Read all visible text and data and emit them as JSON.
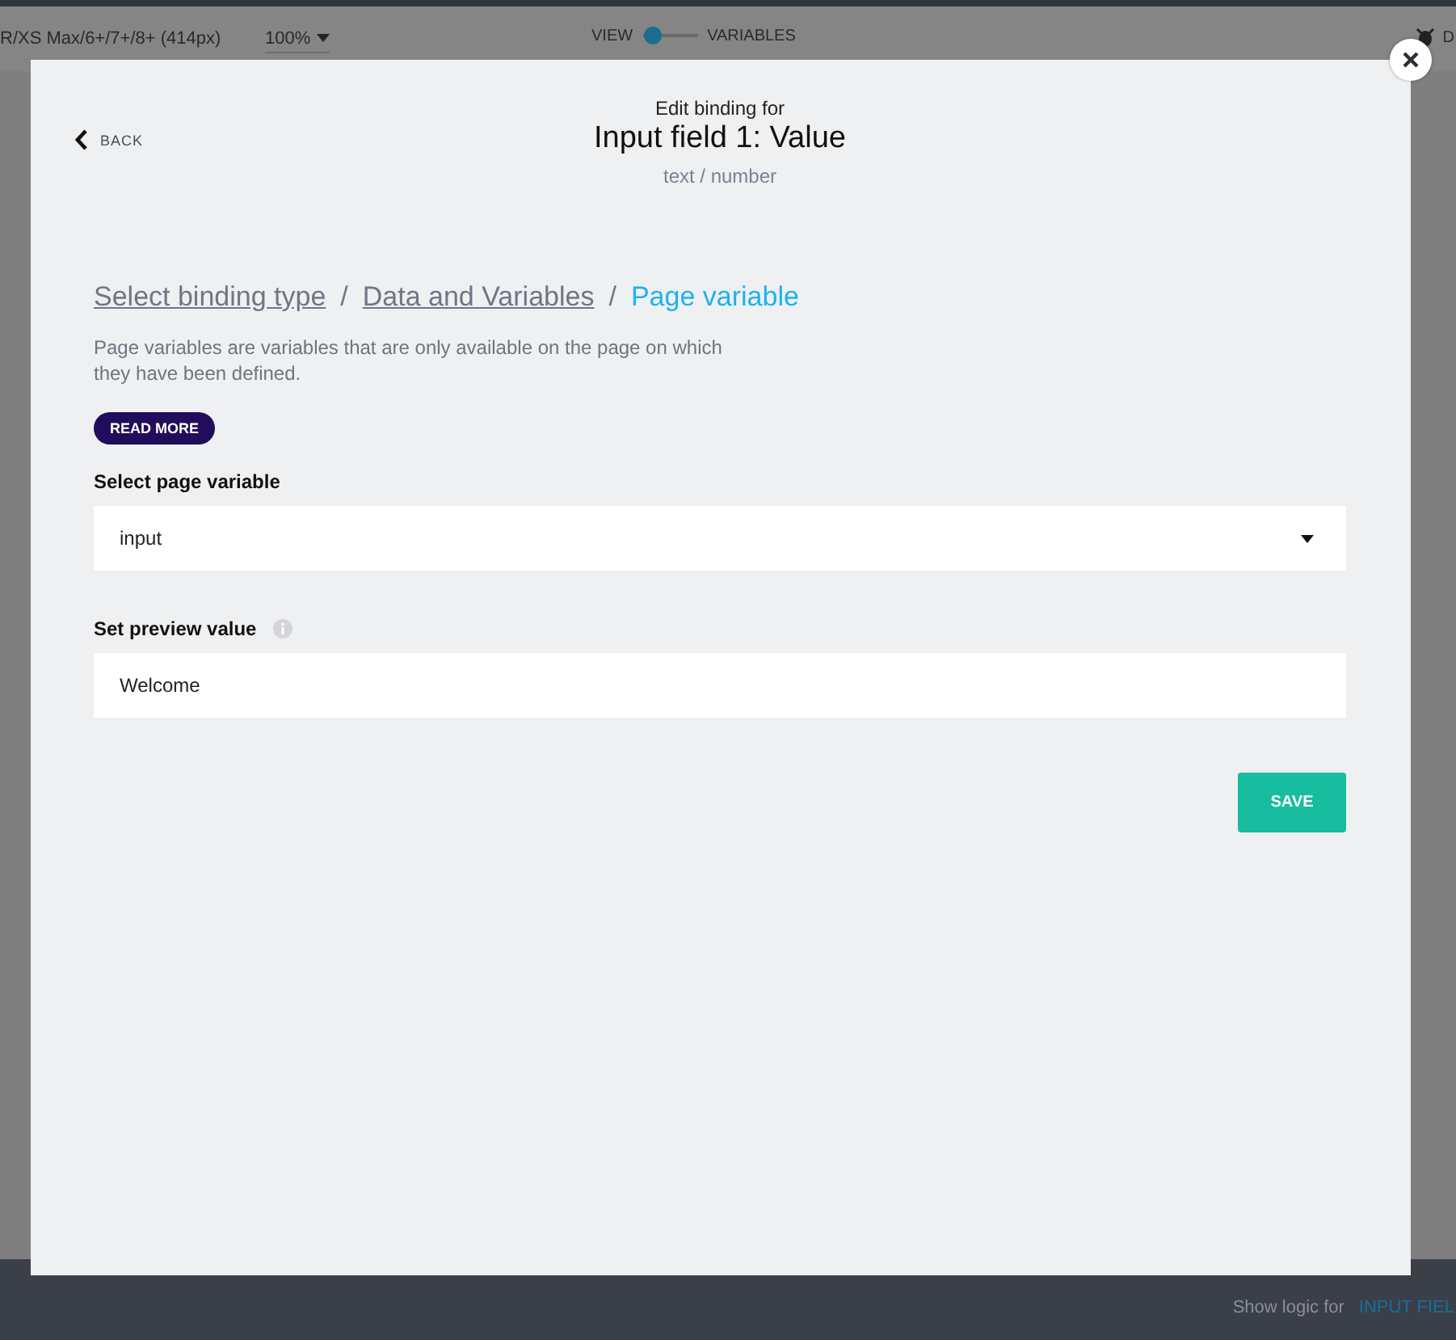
{
  "top_bar": {
    "device": "R/XS Max/6+/7+/8+ (414px)",
    "zoom": "100%",
    "toggle_left": "VIEW",
    "toggle_right": "VARIABLES",
    "toggle_on": false,
    "right_text": "D"
  },
  "modal": {
    "back": "BACK",
    "heading": "Edit binding for",
    "title": "Input field 1: Value",
    "subtitle": "text / number",
    "breadcrumb": [
      {
        "label": "Select binding type",
        "selected": false
      },
      {
        "separator": "/",
        "label": "Data and Variables",
        "selected": false
      },
      {
        "separator": "/",
        "label": "Page variable",
        "selected": true
      }
    ],
    "description": "Page variables are variables that are only available on the page on which they have been defined.",
    "read_more": "READ MORE",
    "fields": [
      {
        "kind": "select",
        "label": "Select page variable",
        "value": "input",
        "info": false
      },
      {
        "kind": "text",
        "label": "Set preview value",
        "value": "Welcome",
        "info": true
      }
    ],
    "save": "SAVE"
  },
  "bottom_bar": {
    "label": "Show logic for",
    "target": "INPUT FIEL"
  }
}
